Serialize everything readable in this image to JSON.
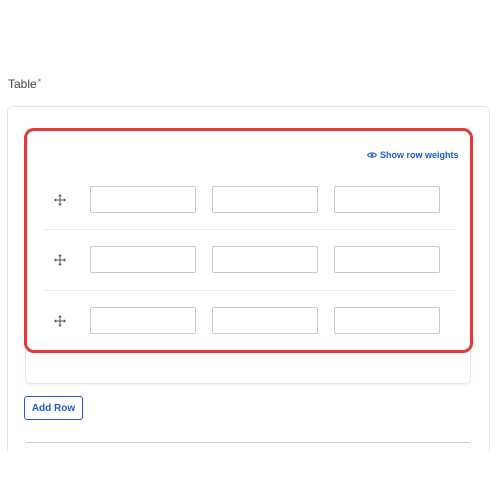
{
  "field": {
    "label": "Table",
    "required_marker": "*"
  },
  "table": {
    "show_weights_label": "Show row weights",
    "show_weights_icon": "eye-icon",
    "drag_icon": "move-icon",
    "rows": [
      {
        "cells": [
          "",
          "",
          ""
        ]
      },
      {
        "cells": [
          "",
          "",
          ""
        ]
      },
      {
        "cells": [
          "",
          "",
          ""
        ]
      }
    ]
  },
  "actions": {
    "add_row_label": "Add Row"
  },
  "colors": {
    "accent": "#1f5ad6",
    "required": "#e0473e",
    "highlight": "#e53935"
  }
}
